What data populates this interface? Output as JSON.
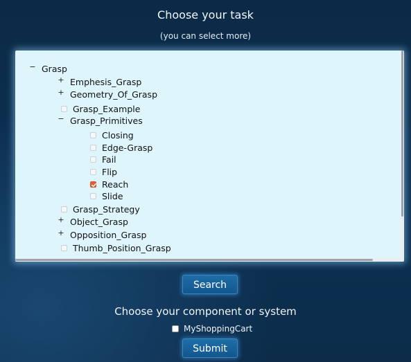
{
  "header": {
    "title": "Choose your task",
    "subtitle": "(you can select more)"
  },
  "tree": {
    "root": {
      "label": "Grasp",
      "expander": "−"
    },
    "items": [
      {
        "label": "Emphesis_Grasp",
        "type": "collapsed",
        "expander": "+"
      },
      {
        "label": "Geometry_Of_Grasp",
        "type": "collapsed",
        "expander": "+"
      },
      {
        "label": "Grasp_Example",
        "type": "leaf",
        "checked": false
      },
      {
        "label": "Grasp_Primitives",
        "type": "expanded",
        "expander": "−"
      },
      {
        "label": "Closing",
        "type": "leaf",
        "checked": false
      },
      {
        "label": "Edge-Grasp",
        "type": "leaf",
        "checked": false
      },
      {
        "label": "Fail",
        "type": "leaf",
        "checked": false
      },
      {
        "label": "Flip",
        "type": "leaf",
        "checked": false
      },
      {
        "label": "Reach",
        "type": "leaf",
        "checked": true
      },
      {
        "label": "Slide",
        "type": "leaf",
        "checked": false
      },
      {
        "label": "Grasp_Strategy",
        "type": "leaf",
        "checked": false
      },
      {
        "label": "Object_Grasp",
        "type": "collapsed",
        "expander": "+"
      },
      {
        "label": "Opposition_Grasp",
        "type": "collapsed",
        "expander": "+"
      },
      {
        "label": "Thumb_Position_Grasp",
        "type": "leaf",
        "checked": false
      }
    ]
  },
  "search_button": {
    "label": "Search"
  },
  "component_section": {
    "label": "Choose your component or system",
    "option": {
      "label": "MyShoppingCart",
      "checked": false
    }
  },
  "submit_button": {
    "label": "Submit"
  },
  "colors": {
    "page_background": "#0c2d4c",
    "tree_background": "#def5fb",
    "checkbox_checked": "#d9643a",
    "button": "#1a659e"
  }
}
